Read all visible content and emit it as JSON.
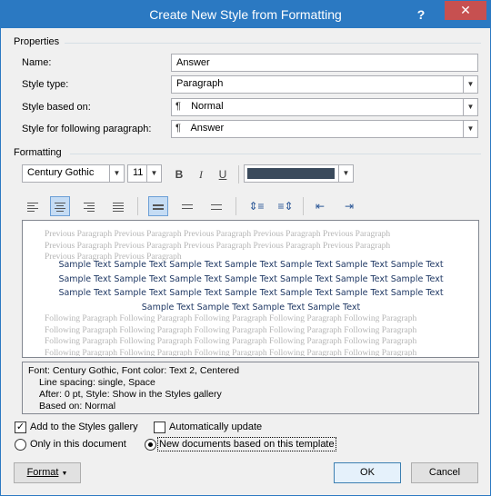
{
  "window": {
    "title": "Create New Style from Formatting",
    "help_label": "?",
    "close_label": "✕"
  },
  "properties": {
    "section_label": "Properties",
    "name_label": "Name:",
    "name_value": "Answer",
    "style_type_label": "Style type:",
    "style_type_value": "Paragraph",
    "based_on_label": "Style based on:",
    "based_on_value": "Normal",
    "following_label": "Style for following paragraph:",
    "following_value": "Answer"
  },
  "formatting": {
    "section_label": "Formatting",
    "font": "Century Gothic",
    "size": "11",
    "bold": "B",
    "italic": "I",
    "underline": "U",
    "color_swatch": "#3a4a5c"
  },
  "preview": {
    "previous_paragraph": "Previous Paragraph Previous Paragraph Previous Paragraph Previous Paragraph Previous Paragraph Previous Paragraph Previous Paragraph Previous Paragraph Previous Paragraph Previous Paragraph Previous Paragraph Previous Paragraph",
    "sample_text": "Sample Text Sample Text Sample Text Sample Text Sample Text Sample Text Sample Text Sample Text Sample Text Sample Text Sample Text Sample Text Sample Text Sample Text Sample Text Sample Text Sample Text Sample Text Sample Text Sample Text Sample Text Sample Text Sample Text Sample Text Sample Text",
    "following_paragraph": "Following Paragraph Following Paragraph Following Paragraph Following Paragraph Following Paragraph Following Paragraph Following Paragraph Following Paragraph Following Paragraph Following Paragraph Following Paragraph Following Paragraph Following Paragraph Following Paragraph Following Paragraph Following Paragraph Following Paragraph Following Paragraph Following Paragraph Following Paragraph Following Paragraph Following Paragraph Following Paragraph Following Paragraph Following Paragraph Following Paragraph Following Paragraph Following Paragraph Following Paragraph Following Paragraph"
  },
  "description": {
    "line1": "Font: Century Gothic, Font color: Text 2, Centered",
    "line2": "Line spacing:  single, Space",
    "line3": "After:  0 pt, Style: Show in the Styles gallery",
    "line4": "Based on: Normal"
  },
  "options": {
    "add_to_gallery_label": "Add to the Styles gallery",
    "auto_update_label": "Automatically update",
    "only_this_doc_label": "Only in this document",
    "new_docs_label": "New documents based on this template"
  },
  "buttons": {
    "format_label": "Format",
    "ok_label": "OK",
    "cancel_label": "Cancel"
  },
  "colors": {
    "titlebar": "#2b79c2",
    "close": "#c75050",
    "sample_text": "#1f3864"
  }
}
